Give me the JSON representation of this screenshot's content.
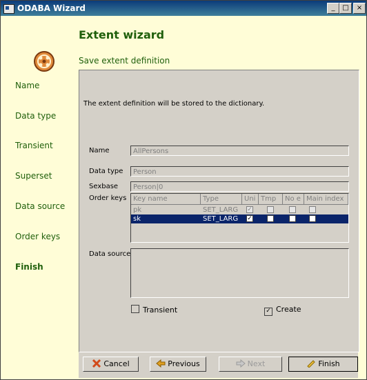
{
  "window": {
    "title": "ODABA Wizard"
  },
  "nav": {
    "items": [
      {
        "label": "Name"
      },
      {
        "label": "Data type"
      },
      {
        "label": "Transient"
      },
      {
        "label": "Superset"
      },
      {
        "label": "Data source"
      },
      {
        "label": "Order keys"
      },
      {
        "label": "Finish"
      }
    ],
    "active": "Finish"
  },
  "header": {
    "title": "Extent wizard",
    "subtitle": "Save extent definition"
  },
  "content": {
    "info": "The extent definition will be stored to the dictionary.",
    "name_label": "Name",
    "name_value": "AllPersons",
    "datatype_label": "Data type",
    "datatype_value": "Person",
    "sexbase_label": "Sexbase",
    "sexbase_value": "Person|0",
    "orderkeys_label": "Order keys",
    "columns": [
      "Key name",
      "Type",
      "Uni",
      "Tmp",
      "No e",
      "Main index"
    ],
    "rows": [
      {
        "key": "pk",
        "type": "SET_LARG",
        "uni": "✓",
        "tmp": "",
        "noe": "",
        "main": ""
      },
      {
        "key": "sk",
        "type": "SET_LARG",
        "uni": "✓",
        "tmp": "",
        "noe": "",
        "main": ""
      }
    ],
    "datasource_label": "Data source",
    "transient_label": "Transient",
    "transient_checked": "",
    "create_label": "Create",
    "create_checked": "✓"
  },
  "buttons": {
    "cancel": "Cancel",
    "previous": "Previous",
    "next": "Next",
    "finish": "Finish"
  },
  "colors": {
    "accent": "#1f5f0b",
    "selection": "#0a246a",
    "panel": "#fffdd7"
  }
}
